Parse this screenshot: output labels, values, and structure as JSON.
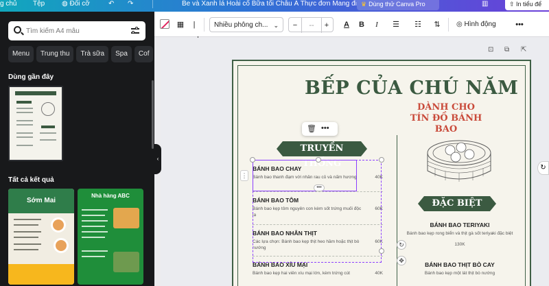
{
  "topbar": {
    "home": "g chủ",
    "file": "Tệp",
    "resize": "Đổi cỡ",
    "undo": "↶",
    "redo": "↷",
    "doc_title": "Be và Xanh lá Hoài cổ Bữa tối Châu Á Thực đơn Mang đi",
    "pro_button": "Dùng thử Canva Pro",
    "analytics": "▥",
    "share": "In tiểu để"
  },
  "sidebar": {
    "search": {
      "placeholder": "Tìm kiếm A4 mẫu"
    },
    "chips": [
      "Menu",
      "Trung thu",
      "Trà sữa",
      "Spa",
      "Cof"
    ],
    "recent_title": "Dùng gần đây",
    "results_title": "Tất cả kết quả",
    "card1_title": "Sớm Mai",
    "card2_title": "Nhà hàng ABC"
  },
  "toolbar": {
    "font": "Nhiều phông ch...",
    "minus": "−",
    "size": "--",
    "plus": "+",
    "color_letter": "A",
    "bold": "B",
    "italic": "I",
    "animate": "Hình động",
    "more": "•••"
  },
  "menu": {
    "title": "BẾP CỦA CHÚ NĂM",
    "subtitle": "DÀNH CHO TÍN ĐỒ BÁNH BAO",
    "left_section": "TRUYỀN THỐNG",
    "right_section": "ĐẶC BIỆT",
    "items": [
      {
        "name": "BÁNH BAO CHAY",
        "desc": "Bánh bao thanh đạm với nhân rau củ và nấm hương",
        "price": "40K"
      },
      {
        "name": "BÁNH BAO TÔM",
        "desc": "Bánh bao kẹp tôm nguyên con kèm sốt trứng muối độc lạ",
        "price": "60K"
      },
      {
        "name": "BÁNH BAO NHÂN THỊT",
        "desc": "Các lựa chọn: Bánh bao kẹp thịt heo hầm hoặc thịt bò nướng",
        "price": "60K"
      },
      {
        "name": "BÁNH BAO XÍU MẠI",
        "desc": "Bánh bao kẹp hai viên xíu mại lớn, kèm trứng cút",
        "price": "40K"
      }
    ],
    "specials": [
      {
        "name": "BÁNH BAO TERIYAKI",
        "desc": "Bánh bao kẹp rong biển và thịt gà sốt teriyaki đặc biệt",
        "price": "130K"
      },
      {
        "name": "BÁNH BAO THỊT BÒ CAY",
        "desc": "Bánh bao kẹp một lát thịt bò nướng",
        "price": ""
      }
    ]
  },
  "canvas": {
    "lock_icon": "⊡",
    "duplicate_icon": "⧉",
    "add_icon": "⇱",
    "float_delete": "🗑",
    "float_more": "•••"
  },
  "colors": {
    "brand_green": "#3b5a41",
    "accent_red": "#c94a3a",
    "selection": "#8b3dff"
  }
}
